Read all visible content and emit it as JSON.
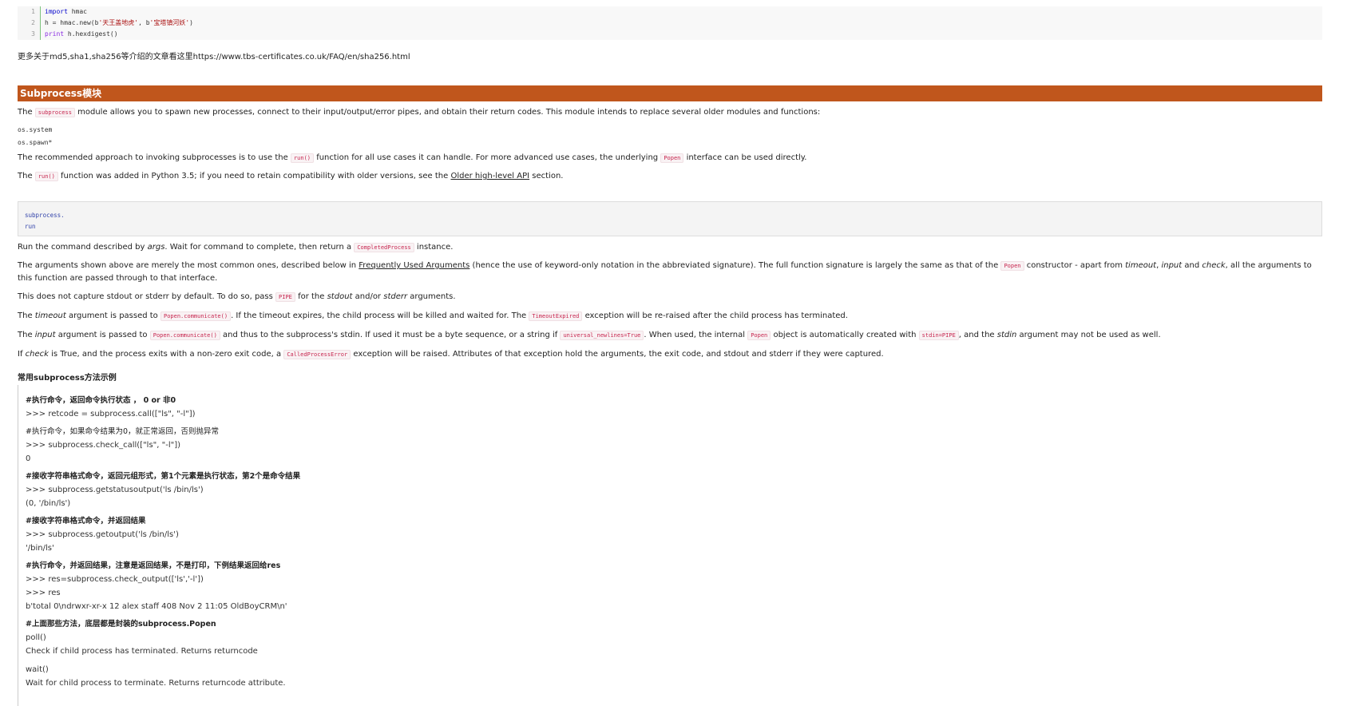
{
  "code_listing": {
    "lines": [
      {
        "num": "1",
        "kw": "import",
        "rest": " hmac"
      },
      {
        "num": "2",
        "pre": "h = hmac.new(b",
        "s1": "'天王盖地虎'",
        "mid": ", b",
        "s2": "'宝塔镇河妖'",
        "post": ")"
      },
      {
        "num": "3",
        "kw": "print",
        "rest": " h.hexdigest()"
      }
    ]
  },
  "more_info": "更多关于md5,sha1,sha256等介绍的文章看这里https://www.tbs-certificates.co.uk/FAQ/en/sha256.html",
  "section_title": "Subprocess模块",
  "intro": {
    "p1_a": "The ",
    "p1_code": "subprocess",
    "p1_b": " module allows you to spawn new processes, connect to their input/output/error pipes, and obtain their return codes. This module intends to replace several older modules and functions:",
    "old1": "os.system",
    "old2": "os.spawn*",
    "p2_a": "The recommended approach to invoking subprocesses is to use the ",
    "p2_code1": "run()",
    "p2_b": " function for all use cases it can handle. For more advanced use cases, the underlying ",
    "p2_code2": "Popen",
    "p2_c": " interface can be used directly.",
    "p3_a": "The ",
    "p3_code": "run()",
    "p3_b": " function was added in Python 3.5; if you need to retain compatibility with older versions, see the ",
    "p3_link": "Older high-level API",
    "p3_c": " section."
  },
  "signature": {
    "line1": "subprocess.",
    "line2": "run"
  },
  "body": {
    "run_a": "Run the command described by ",
    "run_em": "args",
    "run_b": ". Wait for command to complete, then return a ",
    "run_code": "CompletedProcess",
    "run_c": " instance.",
    "args_a": "The arguments shown above are merely the most common ones, described below in ",
    "args_link": "Frequently Used Arguments",
    "args_b": " (hence the use of keyword-only notation in the abbreviated signature). The full function signature is largely the same as that of the ",
    "args_code": "Popen",
    "args_c": " constructor - apart from ",
    "args_em1": "timeout",
    "args_d": ", ",
    "args_em2": "input",
    "args_e": " and ",
    "args_em3": "check",
    "args_f": ", all the arguments to this function are passed through to that interface.",
    "cap_a": "This does not capture stdout or stderr by default. To do so, pass ",
    "cap_code": "PIPE",
    "cap_b": " for the ",
    "cap_em1": "stdout",
    "cap_c": " and/or ",
    "cap_em2": "stderr",
    "cap_d": " arguments.",
    "to_a": "The ",
    "to_em": "timeout",
    "to_b": " argument is passed to ",
    "to_code1": "Popen.communicate()",
    "to_c": ". If the timeout expires, the child process will be killed and waited for. The ",
    "to_code2": "TimeoutExpired",
    "to_d": " exception will be re-raised after the child process has terminated.",
    "in_a": "The ",
    "in_em": "input",
    "in_b": " argument is passed to ",
    "in_code1": "Popen.communicate()",
    "in_c": " and thus to the subprocess's stdin. If used it must be a byte sequence, or a string if ",
    "in_code2": "universal_newlines=True",
    "in_d": ". When used, the internal ",
    "in_code3": "Popen",
    "in_e": " object is automatically created with ",
    "in_code4": "stdin=PIPE",
    "in_f": ", and the ",
    "in_em2": "stdin",
    "in_g": " argument may not be used as well.",
    "chk_a": "If ",
    "chk_em": "check",
    "chk_b": " is True, and the process exits with a non-zero exit code, a ",
    "chk_code": "CalledProcessError",
    "chk_c": " exception will be raised. Attributes of that exception hold the arguments, the exit code, and stdout and stderr if they were captured."
  },
  "examples_heading": "常用subprocess方法示例",
  "examples": {
    "c1": "#执行命令，返回命令执行状态 ， 0 or 非0",
    "l1": ">>> retcode = subprocess.call([\"ls\", \"-l\"])",
    "c2": "#执行命令，如果命令结果为0，就正常返回，否则抛异常",
    "l2": ">>> subprocess.check_call([\"ls\", \"-l\"])",
    "l2b": "0",
    "c3": "#接收字符串格式命令，返回元组形式，第1个元素是执行状态，第2个是命令结果",
    "l3": ">>> subprocess.getstatusoutput('ls /bin/ls')",
    "l3b": "(0, '/bin/ls')",
    "c4": "#接收字符串格式命令，并返回结果",
    "l4": ">>> subprocess.getoutput('ls /bin/ls')",
    "l4b": "'/bin/ls'",
    "c5": "#执行命令，并返回结果，注意是返回结果，不是打印，下例结果返回给res",
    "l5": ">>> res=subprocess.check_output(['ls','-l'])",
    "l5b": ">>> res",
    "l5c": "b'total 0\\ndrwxr-xr-x 12 alex staff 408 Nov 2 11:05 OldBoyCRM\\n'",
    "c6": "#上面那些方法，底层都是封装的subprocess.Popen",
    "l6": "poll()",
    "l6b": "Check if child process has terminated. Returns returncode",
    "l7": "wait()",
    "l7b": "Wait for child process to terminate. Returns returncode attribute."
  }
}
